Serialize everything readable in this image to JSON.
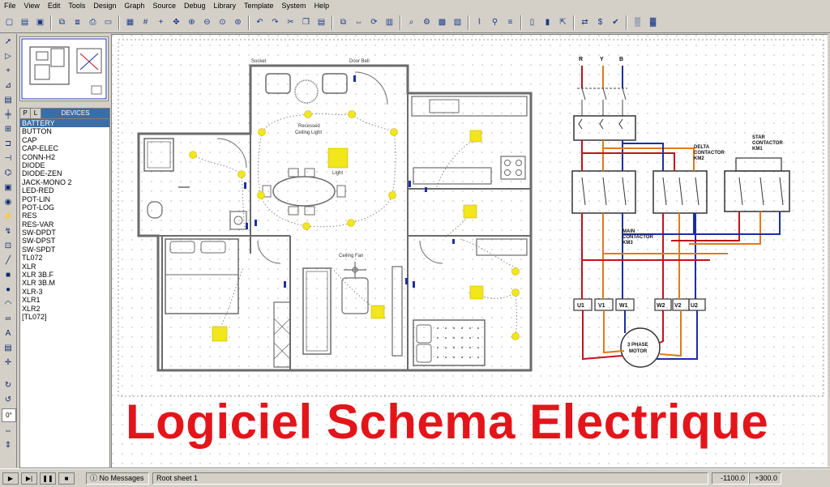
{
  "menu": [
    "File",
    "View",
    "Edit",
    "Tools",
    "Design",
    "Graph",
    "Source",
    "Debug",
    "Library",
    "Template",
    "System",
    "Help"
  ],
  "device_panel": {
    "tab_p": "P",
    "tab_l": "L",
    "title": "DEVICES",
    "items": [
      "BATTERY",
      "BUTTON",
      "CAP",
      "CAP-ELEC",
      "CONN-H2",
      "DIODE",
      "DIODE-ZEN",
      "JACK-MONO 2",
      "LED-RED",
      "POT-LIN",
      "POT-LOG",
      "RES",
      "RES-VAR",
      "SW-DPDT",
      "SW-DPST",
      "SW-SPDT",
      "TL072",
      "XLR",
      "XLR 3B.F",
      "XLR 3B.M",
      "XLR-3",
      "XLR1",
      "XLR2",
      "[TL072]"
    ],
    "selected_index": 0
  },
  "floorplan": {
    "socket": "Socket",
    "door_bell": "Door Bell",
    "recessed": "Recessed",
    "ceiling_light": "Ceiling Light",
    "light": "Light",
    "ceiling_fan": "Ceiling Fan"
  },
  "schematic": {
    "phase_r": "R",
    "phase_y": "Y",
    "phase_b": "B",
    "delta_line1": "DELTA",
    "delta_line2": "CONTACTOR",
    "delta_line3": "KM2",
    "star_line1": "STAR",
    "star_line2": "CONTACTOR",
    "star_line3": "KM1",
    "main_line1": "MAIN",
    "main_line2": "CONTACTOR",
    "main_line3": "KM3",
    "u1": "U1",
    "v1": "V1",
    "w1": "W1",
    "w2": "W2",
    "v2": "V2",
    "u2": "U2",
    "motor_line1": "3 PHASE",
    "motor_line2": "MOTOR"
  },
  "overlay_title": "Logiciel Schema Electrique",
  "status": {
    "messages": "No Messages",
    "sheet": "Root sheet 1",
    "coord_x": "-1100.0",
    "coord_y": "+300.0",
    "angle": "0°"
  },
  "colors": {
    "title_red": "#e3151b",
    "wire_red": "#c0141e",
    "wire_blue": "#1c2fa0",
    "wire_orange": "#e07a1c",
    "lamp_yellow": "#f2e61c",
    "selection_blue": "#3a6ea5"
  }
}
